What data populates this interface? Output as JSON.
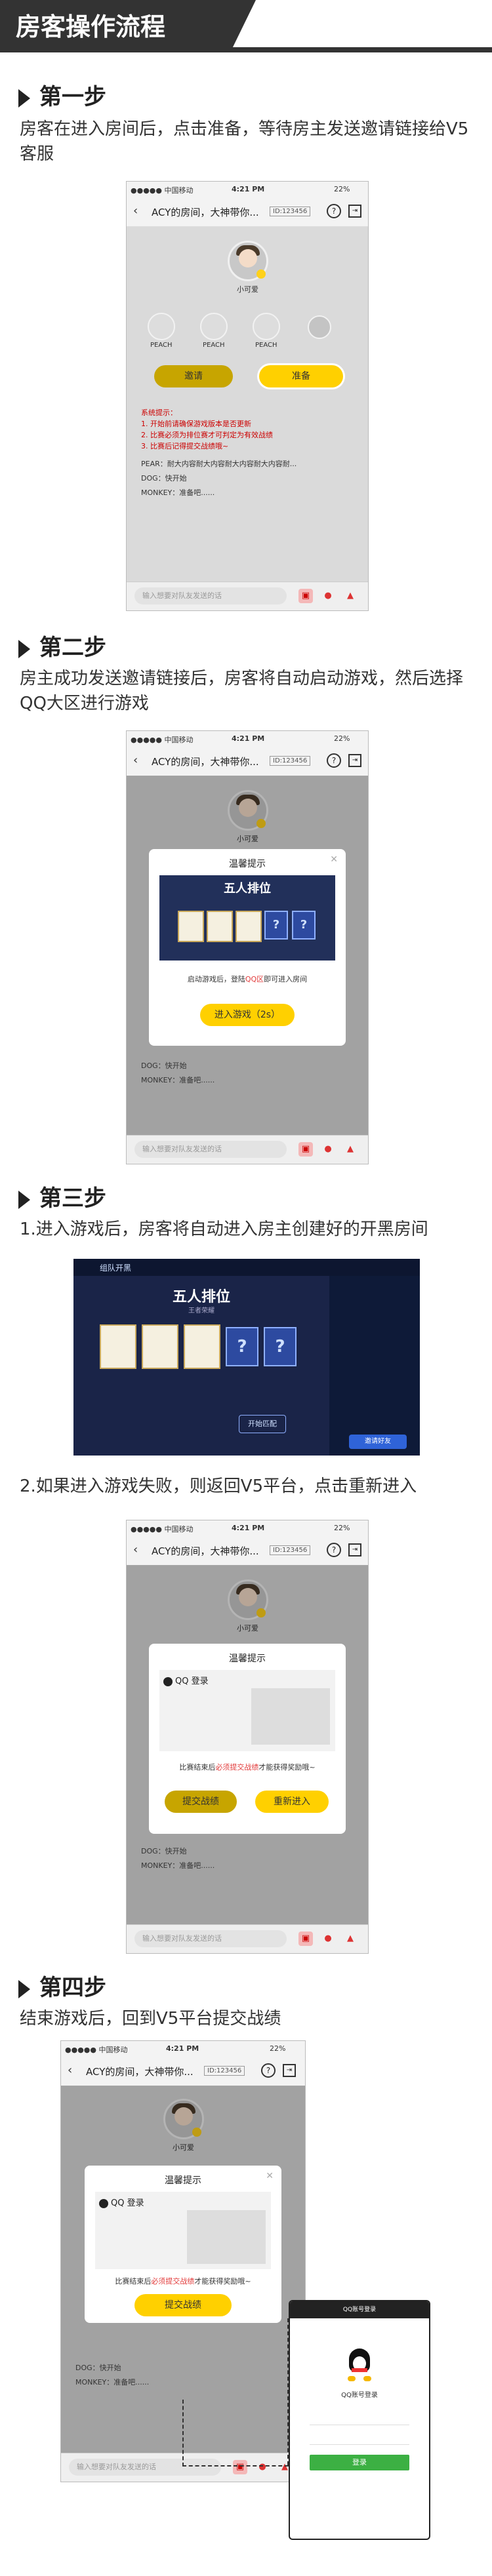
{
  "header": {
    "title": "房客操作流程"
  },
  "colors": {
    "accent": "#ffd000",
    "header_bg": "#333333",
    "red": "#e23b3b"
  },
  "phone_ui": {
    "status_carrier": "●●●●● 中国移动",
    "status_time": "4:21 PM",
    "status_battery": "22%",
    "room_title": "ACY的房间，大神带你...",
    "room_id": "ID:123456",
    "host_name": "小可爱",
    "input_placeholder": "输入想要对队友发送的话",
    "icons": [
      "back-icon",
      "help-icon",
      "exit-icon",
      "gift-icon",
      "mic-icon",
      "alert-icon"
    ]
  },
  "step1": {
    "title": "第一步",
    "desc": "房客在进入房间后，点击准备，等待房主发送邀请链接给V5客服",
    "players": [
      "PEACH",
      "PEACH",
      "PEACH"
    ],
    "invite_label": "邀请",
    "ready_label": "准备",
    "system_lines": [
      "系统提示：",
      "1. 开始前请确保游戏版本是否更新",
      "2. 比赛必须为排位赛才可判定为有效战绩",
      "3. 比赛后记得提交战绩哦~"
    ],
    "chat_lines": [
      "PEAR：耐大内容耐大内容耐大内容耐大内容耐...",
      "DOG：快开始",
      "MONKEY：准备吧......"
    ]
  },
  "step2": {
    "title": "第二步",
    "desc": "房主成功发送邀请链接后，房客将自动启动游戏，然后选择QQ大区进行游戏",
    "modal_title": "温馨提示",
    "game_title": "五人排位",
    "modal_text_pre": "启动游戏后，登陆",
    "modal_text_red": "QQ区",
    "modal_text_post": "即可进入房间",
    "start_btn": "进入游戏（2s）",
    "chat_lines": [
      "DOG：快开始",
      "MONKEY：准备吧......"
    ]
  },
  "step3": {
    "title": "第三步",
    "desc1": "1.进入游戏后，房客将自动进入房主创建好的开黑房间",
    "desc2": "2.如果进入游戏失败，则返回V5平台，点击重新进入",
    "game_header": "组队开黑",
    "game_title": "五人排位",
    "game_subtitle": "王者荣耀",
    "start_btn": "开始匹配",
    "invite_btn": "邀请好友",
    "modal_title": "温馨提示",
    "qq_title": "QQ 登录",
    "modal_text_pre": "比赛结束后",
    "modal_text_red": "必须提交战绩",
    "modal_text_post": "才能获得奖励哦~",
    "submit_btn": "提交战绩",
    "reenter_btn": "重新进入",
    "chat_lines": [
      "DOG：快开始",
      "MONKEY：准备吧......"
    ]
  },
  "step4": {
    "title": "第四步",
    "desc": "结束游戏后，回到V5平台提交战绩",
    "modal_title": "温馨提示",
    "qq_title": "QQ 登录",
    "modal_text_pre": "比赛结束后",
    "modal_text_red": "必须提交战绩",
    "modal_text_post": "才能获得奖励哦~",
    "submit_btn": "提交战绩",
    "chat_lines": [
      "DOG：快开始",
      "MONKEY：准备吧......"
    ],
    "qq_phone_title": "QQ账号登录",
    "qq_phone_name": "QQ账号登录",
    "qq_phone_login": "登录"
  }
}
